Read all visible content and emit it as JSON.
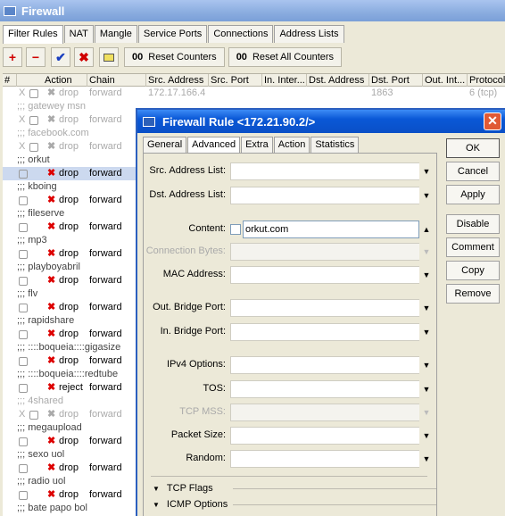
{
  "window": {
    "title": "Firewall"
  },
  "tabs": [
    {
      "label": "Filter Rules",
      "active": true
    },
    {
      "label": "NAT"
    },
    {
      "label": "Mangle"
    },
    {
      "label": "Service Ports"
    },
    {
      "label": "Connections"
    },
    {
      "label": "Address Lists"
    }
  ],
  "toolbar": {
    "add": "+",
    "remove": "−",
    "enable": "✔",
    "disable": "✖",
    "reset_counters": "Reset Counters",
    "reset_all_counters": "Reset All Counters",
    "counter_badge": "00",
    "colors": {
      "add": "#d00000",
      "remove": "#d00000",
      "enable": "#1a3fbf",
      "disable": "#d00000",
      "comment": "#f0e060"
    }
  },
  "grid": {
    "columns": [
      "#",
      "Action",
      "Chain",
      "Src. Address",
      "Src. Port",
      "In. Inter...",
      "Dst. Address",
      "Dst. Port",
      "Out. Int...",
      "Protocol"
    ],
    "rows": [
      {
        "type": "rule",
        "flag": "X",
        "action": "drop",
        "chain": "forward",
        "src_address": "172.17.166.4",
        "dst_port": "1863",
        "protocol": "6 (tcp)",
        "disabled": true
      },
      {
        "type": "comment",
        "text": ";;; gatewey msn",
        "disabled": true
      },
      {
        "type": "rule",
        "flag": "X",
        "action": "drop",
        "chain": "forward",
        "disabled": true
      },
      {
        "type": "comment",
        "text": ";;; facebook.com",
        "disabled": true
      },
      {
        "type": "rule",
        "flag": "X",
        "action": "drop",
        "chain": "forward",
        "disabled": true
      },
      {
        "type": "comment",
        "text": ";;; orkut"
      },
      {
        "type": "rule",
        "action": "drop",
        "chain": "forward",
        "selected": true
      },
      {
        "type": "comment",
        "text": ";;; kboing"
      },
      {
        "type": "rule",
        "action": "drop",
        "chain": "forward"
      },
      {
        "type": "comment",
        "text": ";;; fileserve"
      },
      {
        "type": "rule",
        "action": "drop",
        "chain": "forward"
      },
      {
        "type": "comment",
        "text": ";;; mp3"
      },
      {
        "type": "rule",
        "action": "drop",
        "chain": "forward"
      },
      {
        "type": "comment",
        "text": ";;; playboyabril"
      },
      {
        "type": "rule",
        "action": "drop",
        "chain": "forward"
      },
      {
        "type": "comment",
        "text": ";;; flv"
      },
      {
        "type": "rule",
        "action": "drop",
        "chain": "forward"
      },
      {
        "type": "comment",
        "text": ";;; rapidshare"
      },
      {
        "type": "rule",
        "action": "drop",
        "chain": "forward"
      },
      {
        "type": "comment",
        "text": ";;; ::::boqueia::::gigasize"
      },
      {
        "type": "rule",
        "action": "drop",
        "chain": "forward"
      },
      {
        "type": "comment",
        "text": ";;; ::::boqueia::::redtube"
      },
      {
        "type": "rule",
        "action": "reject",
        "chain": "forward"
      },
      {
        "type": "comment",
        "text": ";;; 4shared",
        "disabled": true
      },
      {
        "type": "rule",
        "flag": "X",
        "action": "drop",
        "chain": "forward",
        "disabled": true
      },
      {
        "type": "comment",
        "text": ";;; megaupload"
      },
      {
        "type": "rule",
        "action": "drop",
        "chain": "forward"
      },
      {
        "type": "comment",
        "text": ";;; sexo uol"
      },
      {
        "type": "rule",
        "action": "drop",
        "chain": "forward"
      },
      {
        "type": "comment",
        "text": ";;; radio uol"
      },
      {
        "type": "rule",
        "action": "drop",
        "chain": "forward"
      },
      {
        "type": "comment",
        "text": ";;; bate papo bol"
      }
    ]
  },
  "dialog": {
    "title": "Firewall Rule <172.21.90.2/>",
    "close": "✕",
    "tabs": [
      {
        "label": "General"
      },
      {
        "label": "Advanced",
        "active": true
      },
      {
        "label": "Extra"
      },
      {
        "label": "Action"
      },
      {
        "label": "Statistics"
      }
    ],
    "fields": {
      "src_address_list": "Src. Address List:",
      "dst_address_list": "Dst. Address List:",
      "content": "Content:",
      "content_value": "orkut.com",
      "connection_bytes": "Connection Bytes:",
      "mac_address": "MAC Address:",
      "out_bridge_port": "Out. Bridge Port:",
      "in_bridge_port": "In. Bridge Port:",
      "ipv4_options": "IPv4 Options:",
      "tos": "TOS:",
      "tcp_mss": "TCP MSS:",
      "packet_size": "Packet Size:",
      "random": "Random:"
    },
    "sections": {
      "tcp_flags": "TCP Flags",
      "icmp_options": "ICMP Options"
    },
    "buttons": {
      "ok": "OK",
      "cancel": "Cancel",
      "apply": "Apply",
      "disable": "Disable",
      "comment": "Comment",
      "copy": "Copy",
      "remove": "Remove"
    }
  }
}
